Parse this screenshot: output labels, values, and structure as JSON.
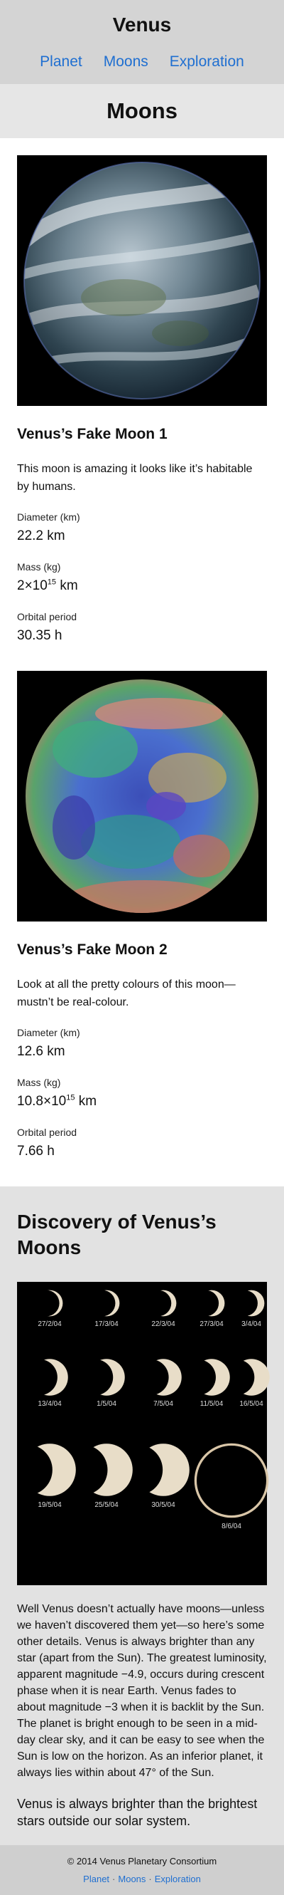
{
  "header": {
    "title": "Venus",
    "nav": [
      "Planet",
      "Moons",
      "Exploration"
    ]
  },
  "page": {
    "heading": "Moons"
  },
  "moons": [
    {
      "name": "Venus’s Fake Moon 1",
      "description": "This moon is amazing it looks like it’s habitable by humans.",
      "diameter_label": "Diameter (km)",
      "diameter_value": "22.2 km",
      "mass_label": "Mass (kg)",
      "mass_base": "2×10",
      "mass_exp": "15",
      "mass_unit": " km",
      "orbital_label": "Orbital period",
      "orbital_value": "30.35 h"
    },
    {
      "name": "Venus’s Fake Moon 2",
      "description": "Look at all the pretty colours of this moon—mustn’t be real-colour.",
      "diameter_label": "Diameter (km)",
      "diameter_value": "12.6 km",
      "mass_label": "Mass (kg)",
      "mass_base": "10.8×10",
      "mass_exp": "15",
      "mass_unit": " km",
      "orbital_label": "Orbital period",
      "orbital_value": "7.66 h"
    }
  ],
  "discovery": {
    "heading": "Discovery of Venus’s Moons",
    "phase_dates": [
      "27/2/04",
      "17/3/04",
      "22/3/04",
      "27/3/04",
      "3/4/04",
      "13/4/04",
      "1/5/04",
      "7/5/04",
      "11/5/04",
      "16/5/04",
      "19/5/04",
      "25/5/04",
      "30/5/04",
      "8/6/04"
    ],
    "text": "Well Venus doesn’t actually have moons—unless we haven’t discovered them yet—so here’s some other details. Venus is always brighter than any star (apart from the Sun). The greatest luminosity, apparent magnitude −4.9, occurs during crescent phase when it is near Earth. Venus fades to about magnitude −3 when it is backlit by the Sun. The planet is bright enough to be seen in a mid-day clear sky, and it can be easy to see when the Sun is low on the horizon. As an inferior planet, it always lies within about 47° of the Sun.",
    "note": "Venus is always brighter than the brightest stars outside our solar system."
  },
  "footer": {
    "copyright": "© 2014 Venus Planetary Consortium",
    "nav": [
      "Planet",
      "Moons",
      "Exploration"
    ],
    "separator": "·"
  },
  "colors": {
    "header_bg": "#d4d4d4",
    "heading_bg": "#e6e6e6",
    "discovery_bg": "#e2e2e2",
    "footer_bg": "#cfcfcf",
    "link": "#1f6fd1"
  }
}
